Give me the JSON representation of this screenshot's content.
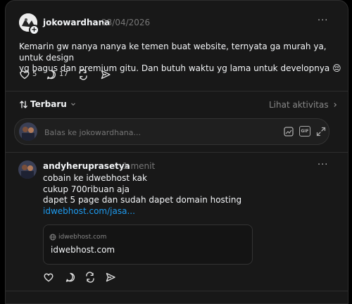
{
  "post": {
    "username": "jokowardhana",
    "date": "23/04/2026",
    "text_lines": [
      "Kemarin gw nanya nanya ke temen buat website, ternyata ga murah ya, untuk design",
      "yg bagus dan premium gitu. Dan butuh waktu yg lama untuk developnya 😔"
    ],
    "likes": "5",
    "replies": "17"
  },
  "sort": {
    "label": "Terbaru",
    "activity_link": "Lihat aktivitas"
  },
  "reply_box": {
    "placeholder": "Balas ke jokowardhana..."
  },
  "reply": {
    "username": "andyheruprasetya",
    "time": "1 menit",
    "lines": [
      "cobain ke idwebhost kak",
      "cukup 700ribuan aja",
      "dapet 5 page dan sudah dapet domain hosting"
    ],
    "link_text": "idwebhost.com/jasa...",
    "preview_domain": "idwebhost.com",
    "preview_title": "idwebhost.com"
  },
  "icons": [
    "plus-icon",
    "more-icon",
    "heart-icon",
    "comment-icon",
    "repost-icon",
    "share-icon",
    "sort-icon",
    "chevron-down-icon",
    "chevron-right-icon",
    "gif-sticker-icon",
    "gif-icon",
    "expand-icon",
    "globe-icon"
  ]
}
